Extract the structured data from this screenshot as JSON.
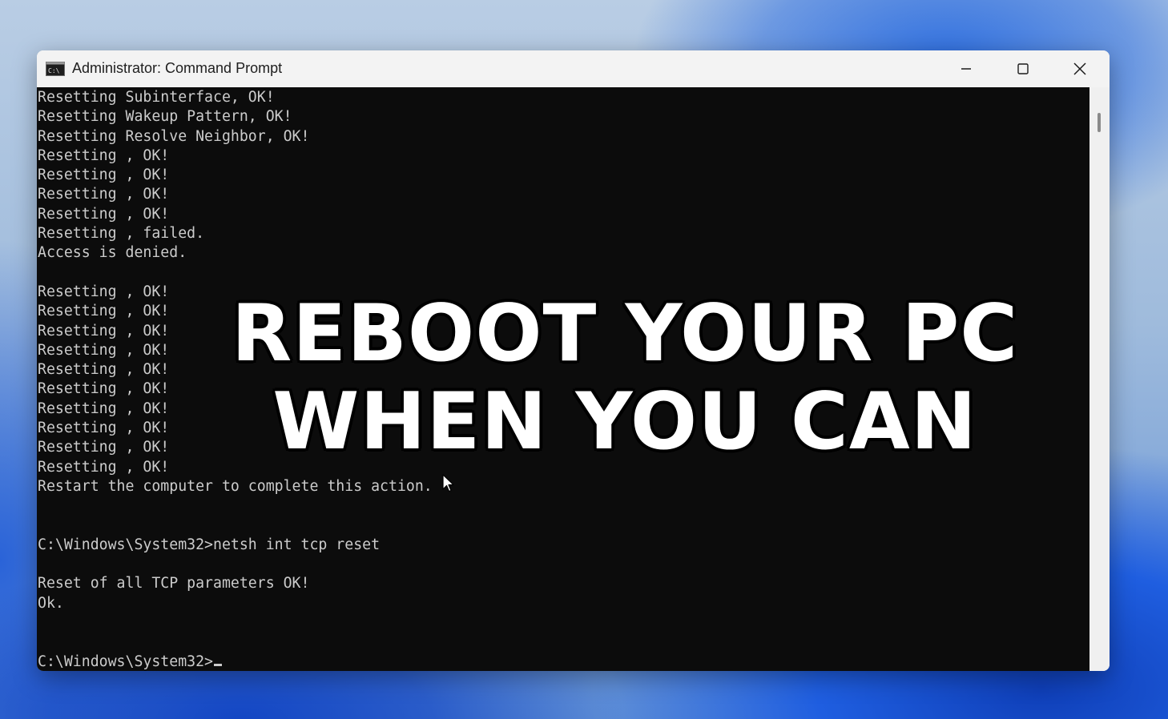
{
  "window": {
    "title": "Administrator: Command Prompt",
    "icon": "cmd-icon",
    "controls": {
      "minimize_icon": "minimize-icon",
      "maximize_icon": "maximize-icon",
      "close_icon": "close-icon"
    }
  },
  "console": {
    "lines": [
      "Resetting Subinterface, OK!",
      "Resetting Wakeup Pattern, OK!",
      "Resetting Resolve Neighbor, OK!",
      "Resetting , OK!",
      "Resetting , OK!",
      "Resetting , OK!",
      "Resetting , OK!",
      "Resetting , failed.",
      "Access is denied.",
      "",
      "Resetting , OK!",
      "Resetting , OK!",
      "Resetting , OK!",
      "Resetting , OK!",
      "Resetting , OK!",
      "Resetting , OK!",
      "Resetting , OK!",
      "Resetting , OK!",
      "Resetting , OK!",
      "Resetting , OK!",
      "Restart the computer to complete this action.",
      "",
      "",
      "C:\\Windows\\System32>netsh int tcp reset",
      "",
      "Reset of all TCP parameters OK!",
      "Ok.",
      "",
      ""
    ],
    "prompt": "C:\\Windows\\System32>",
    "text_color": "#cccccc",
    "background_color": "#0c0c0c"
  },
  "overlay": {
    "line1": "REBOOT YOUR PC",
    "line2": "WHEN YOU CAN"
  },
  "colors": {
    "titlebar": "#f3f3f3",
    "overlay_text": "#ffffff",
    "overlay_outline": "#000000"
  }
}
